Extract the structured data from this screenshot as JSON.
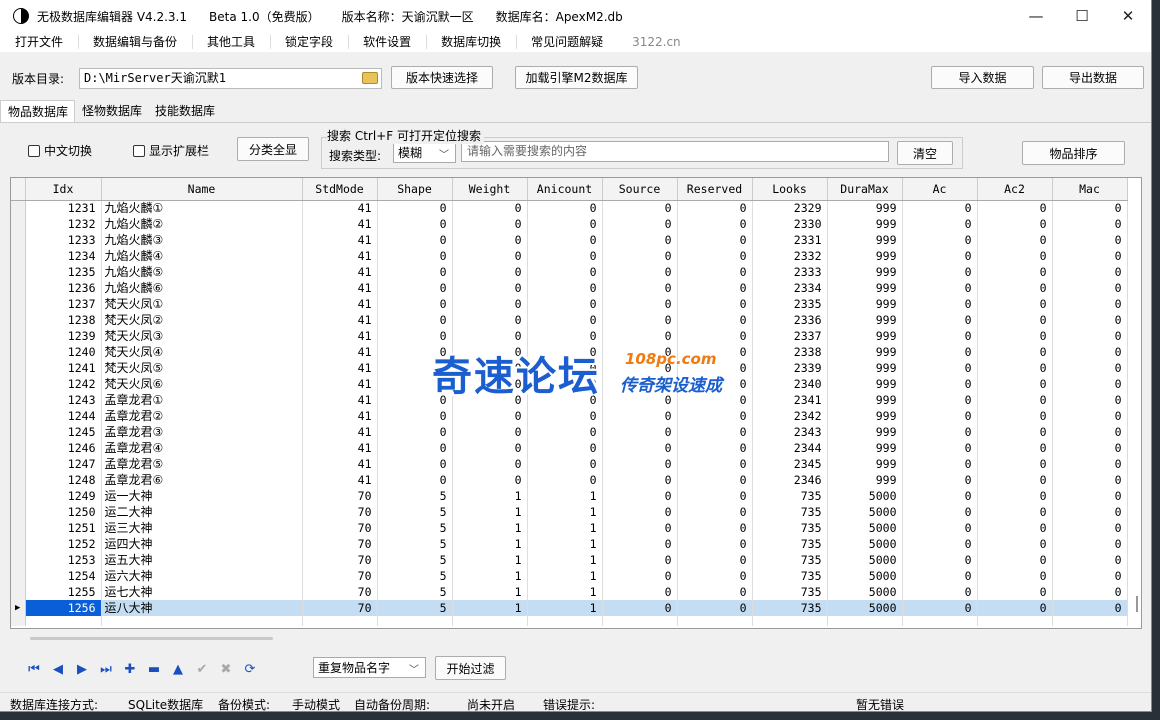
{
  "title": {
    "app_name": "无极数据库编辑器 V4.2.3.1",
    "edition": "Beta 1.0（免费版）",
    "version_label": "版本名称：天谕沉默一区",
    "db_label": "数据库名：ApexM2.db"
  },
  "window_controls": {
    "minimize": "—",
    "maximize": "☐",
    "close": "✕"
  },
  "menu": [
    "打开文件",
    "数据编辑与备份",
    "其他工具",
    "锁定字段",
    "软件设置",
    "数据库切换",
    "常见问题解疑"
  ],
  "menu_extra": "3122.cn",
  "toolbar": {
    "dir_label": "版本目录:",
    "dir_value": "D:\\MirServer天谕沉默1",
    "quick_select": "版本快速选择",
    "load_engine": "加载引擎M2数据库",
    "import": "导入数据",
    "export": "导出数据"
  },
  "tabs": [
    "物品数据库",
    "怪物数据库",
    "技能数据库"
  ],
  "filters": {
    "chinese_toggle": "中文切换",
    "show_ext": "显示扩展栏",
    "show_all": "分类全显",
    "search_title": "搜索   Ctrl+F 可打开定位搜索",
    "search_type_label": "搜索类型:",
    "search_type_value": "模糊",
    "search_placeholder": "请输入需要搜索的内容",
    "clear": "清空",
    "sort": "物品排序"
  },
  "table": {
    "columns": [
      "Idx",
      "Name",
      "StdMode",
      "Shape",
      "Weight",
      "Anicount",
      "Source",
      "Reserved",
      "Looks",
      "DuraMax",
      "Ac",
      "Ac2",
      "Mac"
    ],
    "rows": [
      [
        "1231",
        "九焰火麟①",
        "41",
        "0",
        "0",
        "0",
        "0",
        "0",
        "2329",
        "999",
        "0",
        "0",
        "0"
      ],
      [
        "1232",
        "九焰火麟②",
        "41",
        "0",
        "0",
        "0",
        "0",
        "0",
        "2330",
        "999",
        "0",
        "0",
        "0"
      ],
      [
        "1233",
        "九焰火麟③",
        "41",
        "0",
        "0",
        "0",
        "0",
        "0",
        "2331",
        "999",
        "0",
        "0",
        "0"
      ],
      [
        "1234",
        "九焰火麟④",
        "41",
        "0",
        "0",
        "0",
        "0",
        "0",
        "2332",
        "999",
        "0",
        "0",
        "0"
      ],
      [
        "1235",
        "九焰火麟⑤",
        "41",
        "0",
        "0",
        "0",
        "0",
        "0",
        "2333",
        "999",
        "0",
        "0",
        "0"
      ],
      [
        "1236",
        "九焰火麟⑥",
        "41",
        "0",
        "0",
        "0",
        "0",
        "0",
        "2334",
        "999",
        "0",
        "0",
        "0"
      ],
      [
        "1237",
        "梵天火凤①",
        "41",
        "0",
        "0",
        "0",
        "0",
        "0",
        "2335",
        "999",
        "0",
        "0",
        "0"
      ],
      [
        "1238",
        "梵天火凤②",
        "41",
        "0",
        "0",
        "0",
        "0",
        "0",
        "2336",
        "999",
        "0",
        "0",
        "0"
      ],
      [
        "1239",
        "梵天火凤③",
        "41",
        "0",
        "0",
        "0",
        "0",
        "0",
        "2337",
        "999",
        "0",
        "0",
        "0"
      ],
      [
        "1240",
        "梵天火凤④",
        "41",
        "0",
        "0",
        "0",
        "0",
        "0",
        "2338",
        "999",
        "0",
        "0",
        "0"
      ],
      [
        "1241",
        "梵天火凤⑤",
        "41",
        "0",
        "0",
        "0",
        "0",
        "0",
        "2339",
        "999",
        "0",
        "0",
        "0"
      ],
      [
        "1242",
        "梵天火凤⑥",
        "41",
        "0",
        "0",
        "0",
        "0",
        "0",
        "2340",
        "999",
        "0",
        "0",
        "0"
      ],
      [
        "1243",
        "孟章龙君①",
        "41",
        "0",
        "0",
        "0",
        "0",
        "0",
        "2341",
        "999",
        "0",
        "0",
        "0"
      ],
      [
        "1244",
        "孟章龙君②",
        "41",
        "0",
        "0",
        "0",
        "0",
        "0",
        "2342",
        "999",
        "0",
        "0",
        "0"
      ],
      [
        "1245",
        "孟章龙君③",
        "41",
        "0",
        "0",
        "0",
        "0",
        "0",
        "2343",
        "999",
        "0",
        "0",
        "0"
      ],
      [
        "1246",
        "孟章龙君④",
        "41",
        "0",
        "0",
        "0",
        "0",
        "0",
        "2344",
        "999",
        "0",
        "0",
        "0"
      ],
      [
        "1247",
        "孟章龙君⑤",
        "41",
        "0",
        "0",
        "0",
        "0",
        "0",
        "2345",
        "999",
        "0",
        "0",
        "0"
      ],
      [
        "1248",
        "孟章龙君⑥",
        "41",
        "0",
        "0",
        "0",
        "0",
        "0",
        "2346",
        "999",
        "0",
        "0",
        "0"
      ],
      [
        "1249",
        "运一大神",
        "70",
        "5",
        "1",
        "1",
        "0",
        "0",
        "735",
        "5000",
        "0",
        "0",
        "0"
      ],
      [
        "1250",
        "运二大神",
        "70",
        "5",
        "1",
        "1",
        "0",
        "0",
        "735",
        "5000",
        "0",
        "0",
        "0"
      ],
      [
        "1251",
        "运三大神",
        "70",
        "5",
        "1",
        "1",
        "0",
        "0",
        "735",
        "5000",
        "0",
        "0",
        "0"
      ],
      [
        "1252",
        "运四大神",
        "70",
        "5",
        "1",
        "1",
        "0",
        "0",
        "735",
        "5000",
        "0",
        "0",
        "0"
      ],
      [
        "1253",
        "运五大神",
        "70",
        "5",
        "1",
        "1",
        "0",
        "0",
        "735",
        "5000",
        "0",
        "0",
        "0"
      ],
      [
        "1254",
        "运六大神",
        "70",
        "5",
        "1",
        "1",
        "0",
        "0",
        "735",
        "5000",
        "0",
        "0",
        "0"
      ],
      [
        "1255",
        "运七大神",
        "70",
        "5",
        "1",
        "1",
        "0",
        "0",
        "735",
        "5000",
        "0",
        "0",
        "0"
      ],
      [
        "1256",
        "运八大神",
        "70",
        "5",
        "1",
        "1",
        "0",
        "0",
        "735",
        "5000",
        "0",
        "0",
        "0"
      ]
    ],
    "selected_idx": "1256",
    "selected_marker": "▶",
    "selected_color": "#0a5fd8",
    "selected_row_color": "#c4ddf3"
  },
  "nav": {
    "buttons": [
      {
        "name": "first-record-icon",
        "glyph": "⏮"
      },
      {
        "name": "prior-record-icon",
        "glyph": "◀"
      },
      {
        "name": "next-record-icon",
        "glyph": "▶"
      },
      {
        "name": "last-record-icon",
        "glyph": "⏭"
      },
      {
        "name": "insert-record-icon",
        "glyph": "✚"
      },
      {
        "name": "delete-record-icon",
        "glyph": "▬"
      },
      {
        "name": "edit-record-icon",
        "glyph": "▲"
      },
      {
        "name": "post-record-icon",
        "glyph": "✔"
      },
      {
        "name": "cancel-record-icon",
        "glyph": "✖"
      },
      {
        "name": "refresh-records-icon",
        "glyph": "⟳"
      }
    ],
    "filter_select": "重复物品名字",
    "start_filter": "开始过滤"
  },
  "status": {
    "conn_label": "数据库连接方式:",
    "conn_value": "SQLite数据库",
    "backup_label": "备份模式:",
    "backup_value": "手动模式",
    "auto_label": "自动备份周期:",
    "auto_value": "尚未开启",
    "error_label": "错误提示:",
    "error_value": "暂无错误"
  },
  "watermark": {
    "main": "奇速论坛",
    "url": "108pc.com",
    "sub": "传奇架设速成"
  }
}
